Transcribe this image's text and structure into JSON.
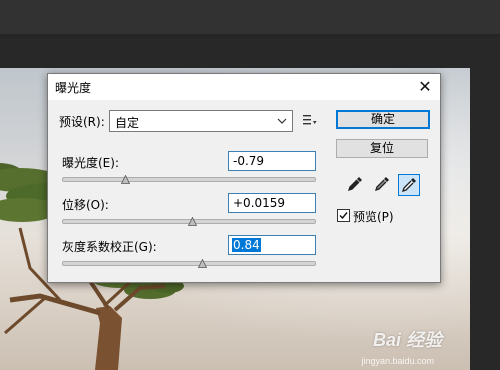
{
  "dialog": {
    "title": "曝光度",
    "close_glyph": "✕",
    "preset": {
      "label": "预设(R):",
      "value": "自定"
    },
    "exposure": {
      "label": "曝光度(E):",
      "value": "-0.79",
      "level": -0.79
    },
    "offset": {
      "label": "位移(O):",
      "value": "+0.0159",
      "level": 0.0159
    },
    "gamma": {
      "label": "灰度系数校正(G):",
      "value": "0.84",
      "level": 0.84
    },
    "buttons": {
      "ok": "确定",
      "reset": "复位"
    },
    "preview": {
      "label": "预览(P)",
      "checked": true
    },
    "eyedroppers": [
      "black-point-eyedropper-icon",
      "gray-point-eyedropper-icon",
      "white-point-eyedropper-icon"
    ]
  },
  "watermark": {
    "brand": "Bai 经验",
    "url": "jingyan.baidu.com"
  },
  "colors": {
    "accent": "#0078d7",
    "dialog_bg": "#f0f0f0",
    "workspace": "#282828"
  }
}
